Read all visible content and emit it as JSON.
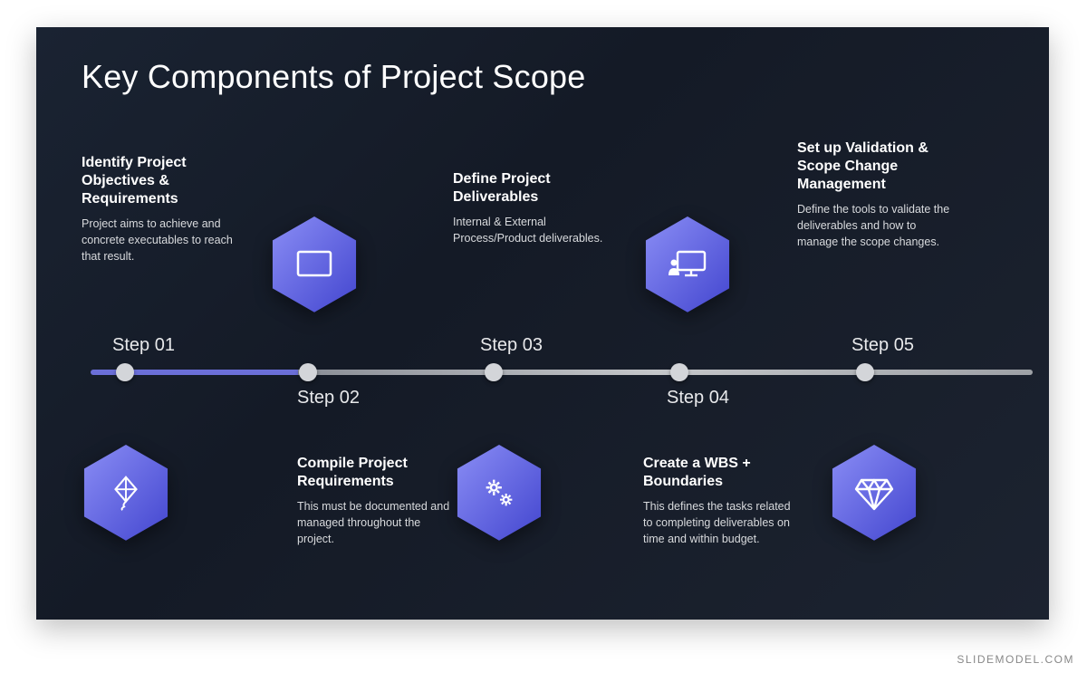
{
  "title": "Key Components of Project Scope",
  "watermark": "SLIDEMODEL.COM",
  "steps": [
    {
      "label": "Step 01",
      "heading": "Identify Project Objectives & Requirements",
      "desc": "Project aims to achieve and concrete executables to reach that result."
    },
    {
      "label": "Step 02",
      "heading": "Compile Project Requirements",
      "desc": "This must be documented and managed throughout the project."
    },
    {
      "label": "Step 03",
      "heading": "Define Project Deliverables",
      "desc": "Internal & External Process/Product deliverables."
    },
    {
      "label": "Step 04",
      "heading": "Create a WBS + Boundaries",
      "desc": "This defines the tasks related to completing deliverables on time and within budget."
    },
    {
      "label": "Step 05",
      "heading": "Set up Validation & Scope Change Management",
      "desc": "Define the tools to validate the deliverables and how to manage the scope changes."
    }
  ],
  "colors": {
    "hex_fill_a": "#7a7df0",
    "hex_fill_b": "#4a4dd0"
  },
  "icons": [
    "kite-icon",
    "monitor-icon",
    "gears-icon",
    "presentation-icon",
    "diamond-icon"
  ]
}
